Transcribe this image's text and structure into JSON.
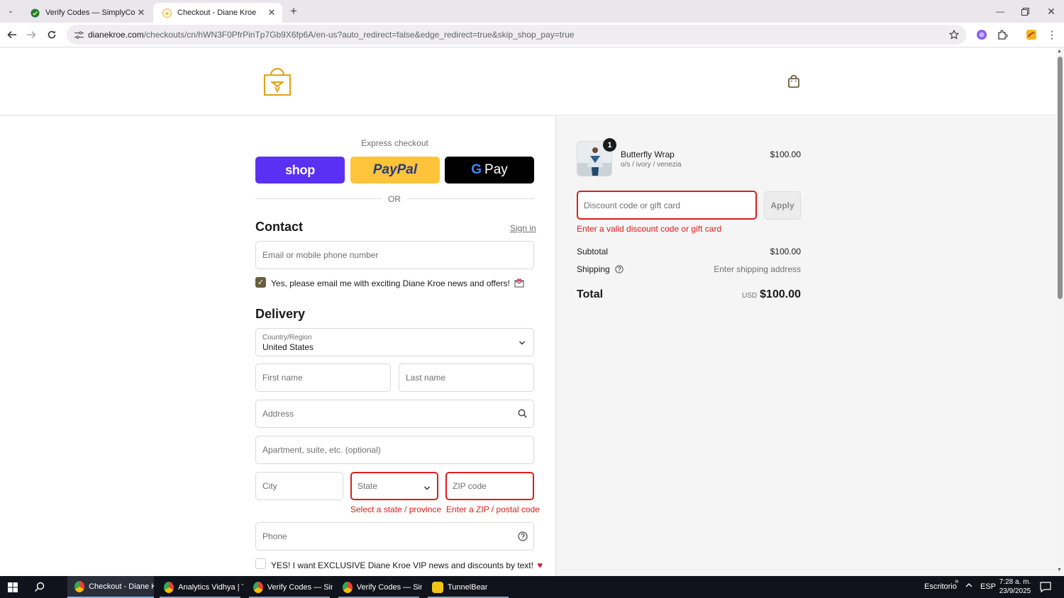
{
  "browser": {
    "tabs": [
      {
        "title": "Verify Codes — SimplyCodes",
        "icon": "simplycodes-icon"
      },
      {
        "title": "Checkout - Diane Kroe",
        "icon": "dianekroe-icon"
      }
    ],
    "url_domain": "dianekroe.com",
    "url_rest": "/checkouts/cn/hWN3F0PfrPinTp7Gb9X6fp6A/en-us?auto_redirect=false&edge_redirect=true&skip_shop_pay=true"
  },
  "checkout": {
    "express_title": "Express checkout",
    "shop_label": "shop",
    "paypal_label": "PayPal",
    "gpay_g": "G",
    "gpay_label": "Pay",
    "or_label": "OR",
    "contact": {
      "heading": "Contact",
      "sign_in": "Sign in",
      "email_placeholder": "Email or mobile phone number",
      "marketing_label": "Yes, please email me with exciting Diane Kroe news and offers!",
      "marketing_checked": true
    },
    "delivery": {
      "heading": "Delivery",
      "country_label": "Country/Region",
      "country_value": "United States",
      "first_name": "First name",
      "last_name": "Last name",
      "address": "Address",
      "apartment": "Apartment, suite, etc. (optional)",
      "city": "City",
      "state": "State",
      "state_error": "Select a state / province",
      "zip": "ZIP code",
      "zip_error": "Enter a ZIP / postal code",
      "phone": "Phone",
      "sms_label": "YES! I want EXCLUSIVE Diane Kroe VIP news and discounts by text!",
      "sms_checked": false
    }
  },
  "summary": {
    "item": {
      "name": "Butterfly Wrap",
      "variant": "o/s / ivory / venezia",
      "price": "$100.00",
      "quantity": "1"
    },
    "discount_placeholder": "Discount code or gift card",
    "apply_label": "Apply",
    "discount_error": "Enter a valid discount code or gift card",
    "subtotal_label": "Subtotal",
    "subtotal_value": "$100.00",
    "shipping_label": "Shipping",
    "shipping_value": "Enter shipping address",
    "total_label": "Total",
    "currency": "USD",
    "total_value": "$100.00"
  },
  "taskbar": {
    "apps": [
      {
        "label": "Checkout - Diane K...",
        "icon": "chrome-icon"
      },
      {
        "label": "Analytics Vidhya | T...",
        "icon": "chrome-icon"
      },
      {
        "label": "Verify Codes — Sim...",
        "icon": "chrome-icon"
      },
      {
        "label": "Verify Codes — Sim...",
        "icon": "chrome-icon"
      },
      {
        "label": "TunnelBear",
        "icon": "tunnelbear-icon"
      }
    ],
    "desktop_label": "Escritorio",
    "language": "ESP",
    "time": "7:28 a. m.",
    "date": "23/9/2025"
  },
  "colors": {
    "shop_purple": "#5a31f4",
    "paypal_yellow": "#ffc439",
    "error_red": "#dd1d1d",
    "brand_gold": "#e3a41c",
    "checkbox_olive": "#6b5e3f"
  }
}
